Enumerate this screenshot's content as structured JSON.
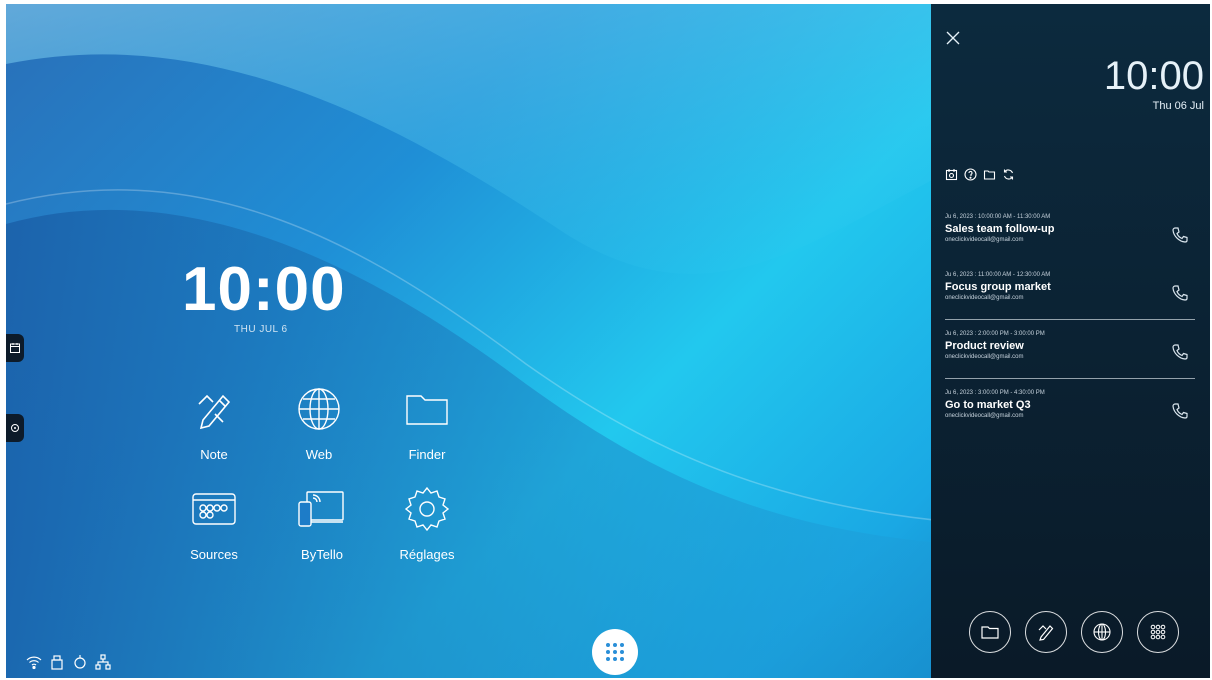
{
  "home": {
    "clock": "10:00",
    "date": "THU JUL 6"
  },
  "apps": [
    {
      "label": "Note",
      "icon": "note-icon"
    },
    {
      "label": "Web",
      "icon": "globe-icon"
    },
    {
      "label": "Finder",
      "icon": "folder-icon"
    },
    {
      "label": "Sources",
      "icon": "sources-icon"
    },
    {
      "label": "ByTello",
      "icon": "screen-share-icon"
    },
    {
      "label": "Réglages",
      "icon": "gear-icon"
    }
  ],
  "panel": {
    "time": "10:00",
    "date": "Thu 06 Jul",
    "events": [
      {
        "when": "Ju 6, 2023 : 10:00:00 AM - 11:30:00 AM",
        "title": "Sales team follow-up",
        "mail": "oneclickvideocall@gmail.com"
      },
      {
        "when": "Ju 6, 2023 : 11:00:00 AM - 12:30:00 AM",
        "title": "Focus group market",
        "mail": "oneclickvideocall@gmail.com"
      },
      {
        "when": "Ju 6, 2023 : 2:00:00 PM - 3:00:00 PM",
        "title": "Product review",
        "mail": "oneclickvideocall@gmail.com"
      },
      {
        "when": "Ju 6, 2023 : 3:00:00 PM - 4:30:00 PM",
        "title": "Go to market Q3",
        "mail": "oneclickvideocall@gmail.com"
      }
    ]
  },
  "colors": {
    "panel_bg": "#0b2233",
    "accent": "#22c8ee"
  }
}
